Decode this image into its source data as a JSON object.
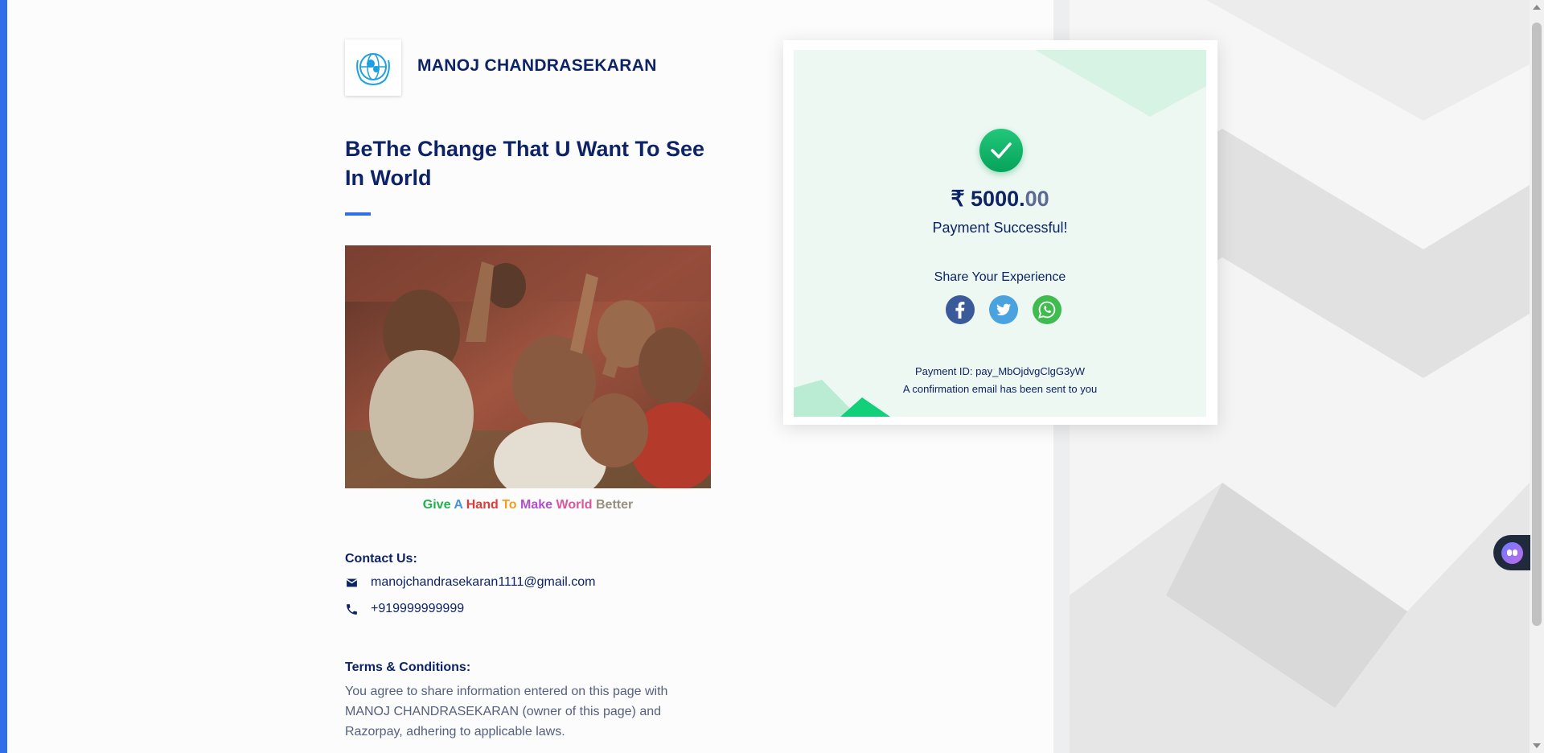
{
  "merchant": {
    "name": "MANOJ CHANDRASEKARAN",
    "logo_icon": "unicef-logo-icon"
  },
  "page": {
    "title": "BeThe Change That U Want To See In World",
    "tagline": [
      {
        "text": "Give",
        "color": "#22b14c"
      },
      {
        "text": "A",
        "color": "#4a90e2"
      },
      {
        "text": "Hand",
        "color": "#e03a3a"
      },
      {
        "text": "To",
        "color": "#f0a01a"
      },
      {
        "text": "Make",
        "color": "#b04fc9"
      },
      {
        "text": "World",
        "color": "#e0559a"
      },
      {
        "text": "Better",
        "color": "#9a8f7f"
      }
    ]
  },
  "contact": {
    "heading": "Contact Us:",
    "email": "manojchandrasekaran1111@gmail.com",
    "phone": "+919999999999",
    "email_icon": "mail-icon",
    "phone_icon": "phone-icon"
  },
  "terms": {
    "heading": "Terms & Conditions:",
    "text": "You agree to share information entered on this page with MANOJ CHANDRASEKARAN (owner of this page) and Razorpay, adhering to applicable laws."
  },
  "payment": {
    "currency_symbol": "₹",
    "amount_whole": " 5000.",
    "amount_decimals": "00",
    "status": "Payment Successful!",
    "share_label": "Share Your Experience",
    "share_icons": [
      "facebook-icon",
      "twitter-icon",
      "whatsapp-icon"
    ],
    "payment_id": "Payment ID: pay_MbOjdvgClgG3yW",
    "confirmation": "A confirmation email has been sent to you",
    "success_icon": "checkmark-icon"
  },
  "colors": {
    "accent": "#2f6fe8",
    "navy": "#0d2366",
    "success": "#0bb35f",
    "card_bg": "#edf8f2"
  }
}
